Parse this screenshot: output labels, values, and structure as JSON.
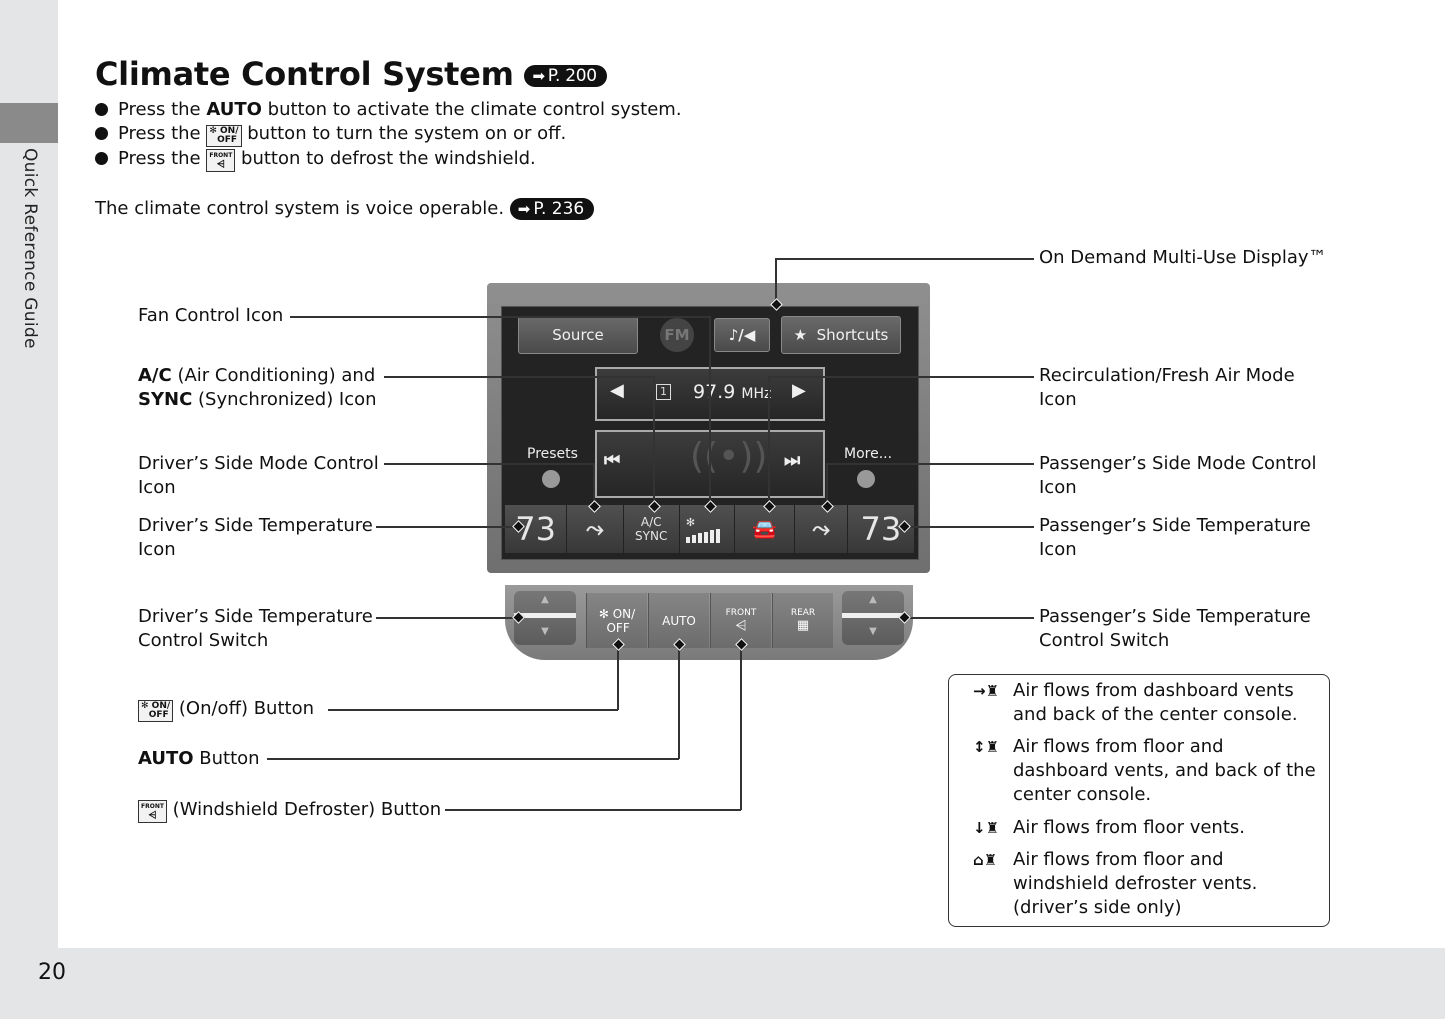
{
  "sidebar": {
    "label": "Quick Reference Guide"
  },
  "page_number": "20",
  "title": "Climate Control System",
  "title_ref": "P. 200",
  "bullets": [
    {
      "pre": "Press the ",
      "bold": "AUTO",
      "post": " button to activate the climate control system."
    },
    {
      "pre": "Press the ",
      "icon": "ON/OFF",
      "post": " button to turn the system on or off."
    },
    {
      "pre": "Press the ",
      "icon": "FRONT",
      "post": " button to defrost the windshield."
    }
  ],
  "voice_text": "The climate control system is voice operable.",
  "voice_ref": "P. 236",
  "callouts_left": {
    "fan": "Fan Control Icon",
    "ac_bold": "A/C",
    "ac_rest": " (Air Conditioning) and",
    "sync_bold": "SYNC",
    "sync_rest": " (Synchronized) Icon",
    "driver_mode_1": "Driver’s Side Mode Control",
    "driver_mode_2": "Icon",
    "driver_temp_1": "Driver’s Side Temperature",
    "driver_temp_2": "Icon",
    "driver_switch_1": "Driver’s Side Temperature",
    "driver_switch_2": "Control Switch",
    "onoff": "(On/off) Button",
    "auto_bold": "AUTO",
    "auto_rest": " Button",
    "defrost": "(Windshield Defroster) Button"
  },
  "callouts_right": {
    "display": "On Demand Multi-Use Display™",
    "recirc_1": "Recirculation/Fresh Air Mode",
    "recirc_2": "Icon",
    "pass_mode_1": "Passenger’s Side Mode Control",
    "pass_mode_2": "Icon",
    "pass_temp_1": "Passenger’s Side Temperature",
    "pass_temp_2": "Icon",
    "pass_switch_1": "Passenger’s Side Temperature",
    "pass_switch_2": "Control Switch"
  },
  "screen": {
    "source": "Source",
    "fm": "FM",
    "audio_icon": "♪/◀",
    "shortcuts": "Shortcuts",
    "preset_num": "1",
    "frequency": "97.9",
    "unit": "MHz",
    "presets": "Presets",
    "more": "More...",
    "driver_temp": "73",
    "passenger_temp": "73",
    "ac": "A/C",
    "sync": "SYNC",
    "fan_level_bars": 6
  },
  "lower_panel": {
    "on": "ON/",
    "off": "OFF",
    "auto": "AUTO",
    "front": "FRONT",
    "rear": "REAR"
  },
  "legend": [
    {
      "icon": "vent-dash",
      "glyph": "→♜",
      "text": "Air flows from dashboard vents and back of the center console."
    },
    {
      "icon": "vent-floor-dash",
      "glyph": "↕♜",
      "text": "Air flows from floor and dashboard vents, and back of the center console."
    },
    {
      "icon": "vent-floor",
      "glyph": "↓♜",
      "text": "Air flows from floor vents."
    },
    {
      "icon": "vent-floor-defrost",
      "glyph": "⌂♜",
      "text": "Air flows from floor and windshield defroster vents. (driver’s side only)"
    }
  ]
}
